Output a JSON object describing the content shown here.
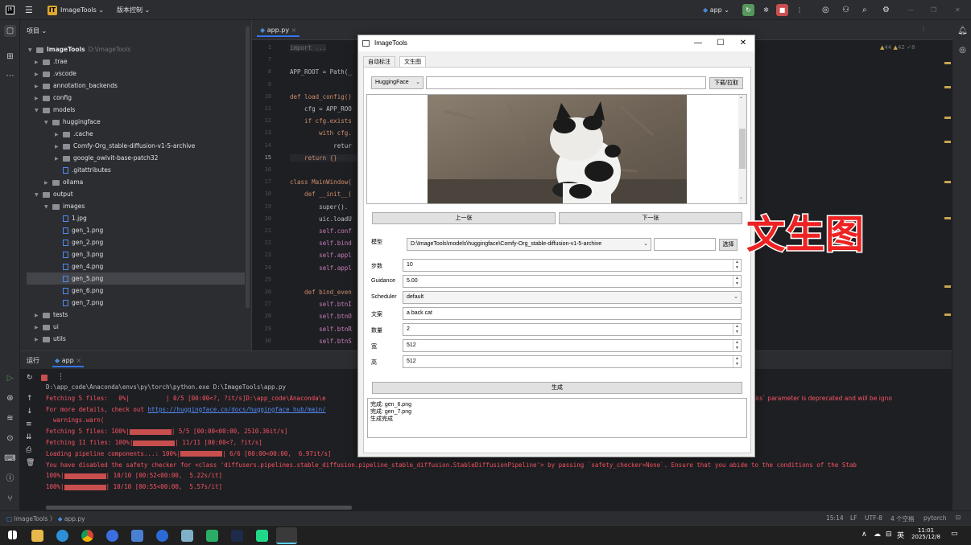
{
  "topbar": {
    "logo": "JB",
    "project_badge": "IT",
    "project_name": "ImageTools",
    "vcs": "版本控制",
    "run_config": "app"
  },
  "project_panel": {
    "title": "项目",
    "root_name": "ImageTools",
    "root_path": "D:\\ImageTools",
    "items": [
      {
        "label": ".trae",
        "kind": "folder",
        "depth": 1,
        "expanded": false
      },
      {
        "label": ".vscode",
        "kind": "folder",
        "depth": 1,
        "expanded": false
      },
      {
        "label": "annotation_backends",
        "kind": "folder",
        "depth": 1,
        "expanded": false
      },
      {
        "label": "config",
        "kind": "folder",
        "depth": 1,
        "expanded": false
      },
      {
        "label": "models",
        "kind": "folder",
        "depth": 1,
        "expanded": true
      },
      {
        "label": "huggingface",
        "kind": "folder",
        "depth": 2,
        "expanded": true
      },
      {
        "label": ".cache",
        "kind": "folder",
        "depth": 3,
        "expanded": false
      },
      {
        "label": "Comfy-Org_stable-diffusion-v1-5-archive",
        "kind": "folder",
        "depth": 3,
        "expanded": false
      },
      {
        "label": "google_owlvit-base-patch32",
        "kind": "folder",
        "depth": 3,
        "expanded": false
      },
      {
        "label": ".gitattributes",
        "kind": "file",
        "depth": 3
      },
      {
        "label": "ollama",
        "kind": "folder",
        "depth": 2,
        "expanded": false
      },
      {
        "label": "output",
        "kind": "folder",
        "depth": 1,
        "expanded": true
      },
      {
        "label": "images",
        "kind": "folder",
        "depth": 2,
        "expanded": true
      },
      {
        "label": "1.jpg",
        "kind": "file",
        "depth": 3
      },
      {
        "label": "gen_1.png",
        "kind": "file",
        "depth": 3
      },
      {
        "label": "gen_2.png",
        "kind": "file",
        "depth": 3
      },
      {
        "label": "gen_3.png",
        "kind": "file",
        "depth": 3
      },
      {
        "label": "gen_4.png",
        "kind": "file",
        "depth": 3
      },
      {
        "label": "gen_5.png",
        "kind": "file",
        "depth": 3,
        "selected": true
      },
      {
        "label": "gen_6.png",
        "kind": "file",
        "depth": 3
      },
      {
        "label": "gen_7.png",
        "kind": "file",
        "depth": 3
      },
      {
        "label": "tests",
        "kind": "folder",
        "depth": 1,
        "expanded": false
      },
      {
        "label": "ui",
        "kind": "folder",
        "depth": 1,
        "expanded": false
      },
      {
        "label": "utils",
        "kind": "folder",
        "depth": 1,
        "expanded": false
      }
    ]
  },
  "editor": {
    "tab": "app.py",
    "inspections": {
      "warnings": "44",
      "weak": "42",
      "typos": "8"
    },
    "lines": [
      {
        "n": "1",
        "text": "import ..."
      },
      {
        "n": "7",
        "text": ""
      },
      {
        "n": "8",
        "text": "APP_ROOT = Path(_"
      },
      {
        "n": "9",
        "text": ""
      },
      {
        "n": "10",
        "text": "def load_config()"
      },
      {
        "n": "11",
        "text": "    cfg = APP_ROO"
      },
      {
        "n": "12",
        "text": "    if cfg.exists"
      },
      {
        "n": "13",
        "text": "        with cfg."
      },
      {
        "n": "14",
        "text": "            retur"
      },
      {
        "n": "15",
        "text": "    return {}"
      },
      {
        "n": "16",
        "text": ""
      },
      {
        "n": "17",
        "text": "class MainWindow("
      },
      {
        "n": "18",
        "text": "    def __init__("
      },
      {
        "n": "19",
        "text": "        super()."
      },
      {
        "n": "20",
        "text": "        uic.loadU"
      },
      {
        "n": "21",
        "text": "        self.conf"
      },
      {
        "n": "22",
        "text": "        self.bind"
      },
      {
        "n": "23",
        "text": "        self.appl"
      },
      {
        "n": "24",
        "text": "        self.appl"
      },
      {
        "n": "25",
        "text": ""
      },
      {
        "n": "26",
        "text": "    def bind_even"
      },
      {
        "n": "27",
        "text": "        self.btnI"
      },
      {
        "n": "28",
        "text": "        self.btnO"
      },
      {
        "n": "29",
        "text": "        self.btnR"
      },
      {
        "n": "30",
        "text": "        self.btnS"
      },
      {
        "n": "31",
        "text": "        if hasatt"
      },
      {
        "n": "32",
        "text": "            self."
      }
    ]
  },
  "run_panel": {
    "tab_run": "运行",
    "tab_app": "app",
    "lines": [
      {
        "t": "D:\\app_code\\Anaconda\\envs\\py\\torch\\python.exe D:\\ImageTools\\app.py",
        "c": "wh"
      },
      {
        "t": "Fetching 5 files:   0%|          | 0/5 [00:00<?, ?it/s]D:\\app_code\\Anaconda\\e",
        "c": "red"
      },
      {
        "t": "For more details, check out ",
        "c": "red",
        "link": "https://huggingface.co/docs/huggingface_hub/main/"
      },
      {
        "t": "  warnings.warn(",
        "c": "red"
      },
      {
        "t": "Fetching 5 files: 100%|",
        "c": "red",
        "bar": true,
        "tail": "| 5/5 [00:00<00:00, 2510.36it/s]"
      },
      {
        "t": "Fetching 11 files: 100%|",
        "c": "red",
        "bar": true,
        "tail": "| 11/11 [00:00<?, ?it/s]"
      },
      {
        "t": "Loading pipeline components...: 100%|",
        "c": "red",
        "bar": true,
        "tail": "| 6/6 [00:00<00:00,  6.97it/s]"
      },
      {
        "t": "You have disabled the safety checker for <class 'diffusers.pipelines.stable_diffusion.pipeline_stable_diffusion.StableDiffusionPipeline'> by passing `safety_checker=None`. Ensure that you abide to the conditions of the Stab",
        "c": "red"
      },
      {
        "t": "100%|",
        "c": "red",
        "bar": true,
        "tail": "| 10/10 [00:52<00:00,  5.22s/it]"
      },
      {
        "t": "100%|",
        "c": "red",
        "bar": true,
        "tail": "| 10/10 [00:55<00:00,  5.57s/it]"
      }
    ],
    "right_overflow": "links` parameter is deprecated and will be igno"
  },
  "statusbar": {
    "crumb_project": "ImageTools",
    "crumb_file": "app.py",
    "position": "15:14",
    "line_sep": "LF",
    "encoding": "UTF-8",
    "indent": "4 个空格",
    "interpreter": "pytorch"
  },
  "taskbar": {
    "time": "11:01",
    "date": "2025/12/8",
    "ime": "英"
  },
  "dialog": {
    "title": "ImageTools",
    "tabs": [
      "自动标注",
      "文生图"
    ],
    "active_tab": 1,
    "source_combo": "HuggingFace",
    "url_value": "",
    "download_btn": "下载/拉取",
    "prev_btn": "上一张",
    "next_btn": "下一张",
    "model_label": "模型",
    "model_value": "D:\\ImageTools\\models\\huggingface\\Comfy-Org_stable-diffusion-v1-5-archive",
    "model_extra": "",
    "choose_btn": "选择",
    "steps_label": "步数",
    "steps_value": "10",
    "guidance_label": "Guidance",
    "guidance_value": "5.00",
    "scheduler_label": "Scheduler",
    "scheduler_value": "default",
    "prompt_label": "文案",
    "prompt_value": "a back cat",
    "count_label": "数量",
    "count_value": "2",
    "width_label": "宽",
    "width_value": "512",
    "height_label": "高",
    "height_value": "512",
    "generate_btn": "生成",
    "log": [
      "完成: gen_6.png",
      "完成: gen_7.png",
      "生成完成"
    ]
  },
  "overlay": {
    "text": "文生图",
    "color": "#ee2222"
  }
}
